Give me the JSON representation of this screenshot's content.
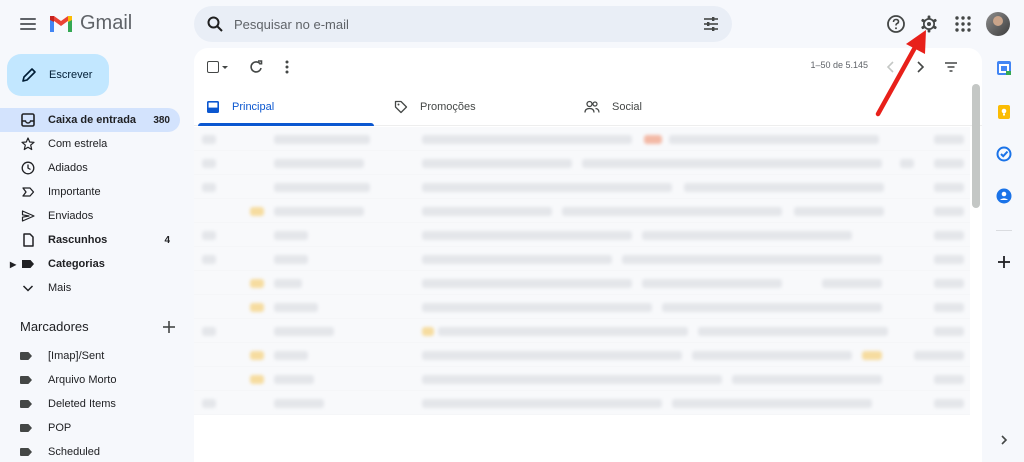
{
  "app": {
    "name": "Gmail"
  },
  "search": {
    "placeholder": "Pesquisar no e-mail"
  },
  "compose": {
    "label": "Escrever"
  },
  "nav": {
    "items": [
      {
        "label": "Caixa de entrada",
        "count": "380",
        "icon": "inbox-icon",
        "active": true
      },
      {
        "label": "Com estrela",
        "count": "",
        "icon": "star-icon"
      },
      {
        "label": "Adiados",
        "count": "",
        "icon": "clock-icon"
      },
      {
        "label": "Importante",
        "count": "",
        "icon": "important-icon"
      },
      {
        "label": "Enviados",
        "count": "",
        "icon": "send-icon"
      },
      {
        "label": "Rascunhos",
        "count": "4",
        "icon": "draft-icon",
        "bold": true
      },
      {
        "label": "Categorias",
        "count": "",
        "icon": "label-icon",
        "bold": true
      },
      {
        "label": "Mais",
        "count": "",
        "icon": "chevron-down-icon"
      }
    ]
  },
  "labels": {
    "title": "Marcadores",
    "items": [
      "[Imap]/Sent",
      "Arquivo Morto",
      "Deleted Items",
      "POP",
      "Scheduled"
    ]
  },
  "toolbar": {
    "range": "1–50 de 5.145"
  },
  "tabs": [
    {
      "label": "Principal",
      "icon": "inbox-icon"
    },
    {
      "label": "Promoções",
      "icon": "tag-icon"
    },
    {
      "label": "Social",
      "icon": "people-icon"
    }
  ],
  "colors": {
    "accent": "#0b57d0",
    "compose_bg": "#c2e7ff",
    "active_nav": "#d3e3fd",
    "annotation_arrow": "#e8201a"
  }
}
